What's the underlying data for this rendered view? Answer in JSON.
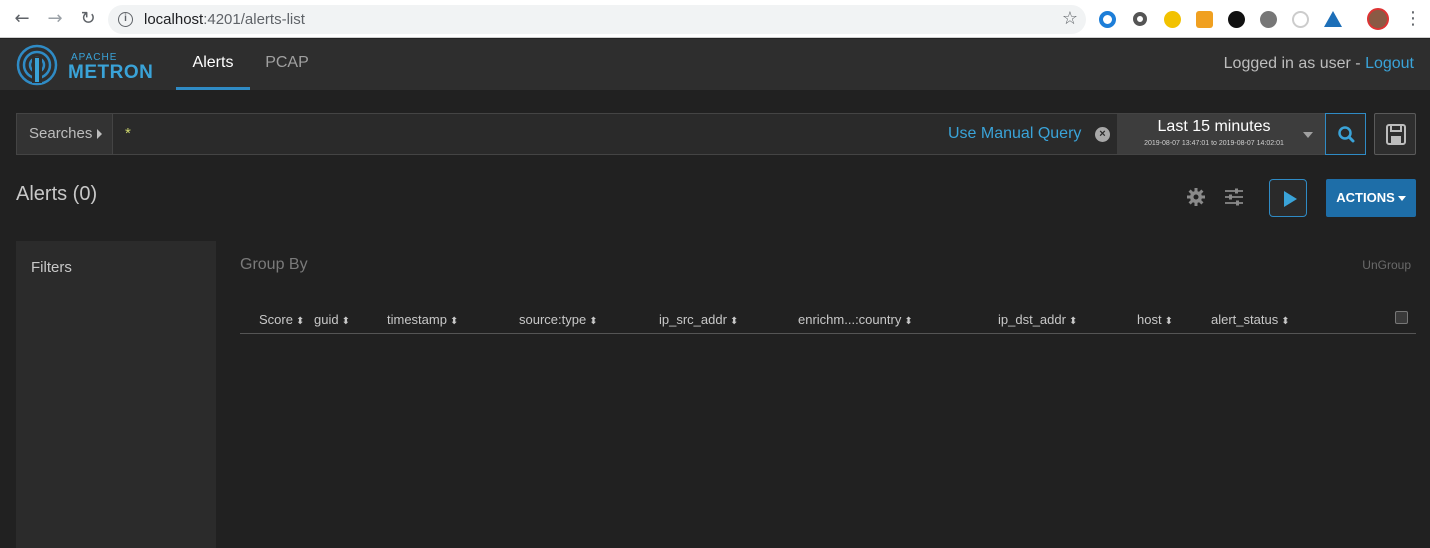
{
  "browser": {
    "url_host": "localhost",
    "url_path": ":4201/alerts-list"
  },
  "app": {
    "logo_top": "APACHE",
    "logo_bottom": "METRON",
    "tabs": [
      {
        "label": "Alerts"
      },
      {
        "label": "PCAP"
      }
    ],
    "logged_in_text": "Logged in as user - ",
    "logout_label": "Logout"
  },
  "search": {
    "searches_label": "Searches",
    "query": "*",
    "manual_query_label": "Use Manual Query",
    "time_range_label": "Last 15 minutes",
    "time_range_detail": "2019-08-07 13:47:01 to 2019-08-07 14:02:01"
  },
  "alerts": {
    "title": "Alerts (0)",
    "actions_label": "ACTIONS"
  },
  "filters": {
    "title": "Filters"
  },
  "table": {
    "group_by_label": "Group By",
    "ungroup_label": "UnGroup",
    "columns": [
      {
        "label": "Score"
      },
      {
        "label": "guid"
      },
      {
        "label": "timestamp"
      },
      {
        "label": "source:type"
      },
      {
        "label": "ip_src_addr"
      },
      {
        "label": "enrichm...:country"
      },
      {
        "label": "ip_dst_addr"
      },
      {
        "label": "host"
      },
      {
        "label": "alert_status"
      }
    ]
  },
  "colors": {
    "accent": "#3aa3d8",
    "background": "#212121",
    "actions_button": "#1e6ea8"
  }
}
